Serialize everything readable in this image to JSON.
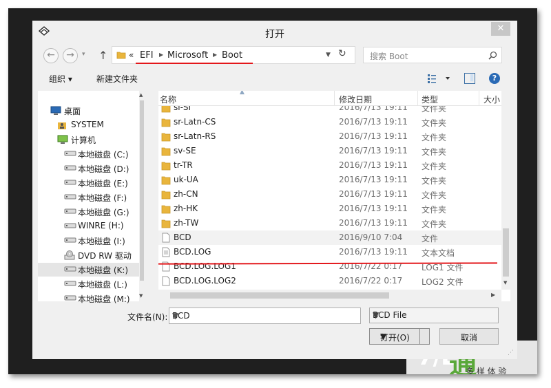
{
  "window": {
    "title": "打开",
    "close_glyph": "✕"
  },
  "address": {
    "chevron": "«",
    "segments": [
      "EFI",
      "Microsoft",
      "Boot"
    ]
  },
  "search": {
    "placeholder": "搜索 Boot"
  },
  "toolbar": {
    "organize": "组织 ▾",
    "new_folder": "新建文件夹"
  },
  "nav_tree": [
    {
      "label": "桌面",
      "icon": "desktop-icon"
    },
    {
      "label": "SYSTEM",
      "icon": "user-folder-icon"
    },
    {
      "label": "计算机",
      "icon": "computer-icon"
    },
    {
      "label": "本地磁盘 (C:)",
      "icon": "drive-icon"
    },
    {
      "label": "本地磁盘 (D:)",
      "icon": "drive-icon"
    },
    {
      "label": "本地磁盘 (E:)",
      "icon": "drive-icon"
    },
    {
      "label": "本地磁盘 (F:)",
      "icon": "drive-icon"
    },
    {
      "label": "本地磁盘 (G:)",
      "icon": "drive-icon"
    },
    {
      "label": "WINRE (H:)",
      "icon": "drive-icon"
    },
    {
      "label": "本地磁盘 (I:)",
      "icon": "drive-icon"
    },
    {
      "label": "DVD RW 驱动",
      "icon": "dvd-drive-icon"
    },
    {
      "label": "本地磁盘 (K:)",
      "icon": "drive-icon",
      "selected": true
    },
    {
      "label": "本地磁盘 (L:)",
      "icon": "drive-icon"
    },
    {
      "label": "本地磁盘 (M:)",
      "icon": "drive-icon"
    }
  ],
  "columns": [
    "名称",
    "修改日期",
    "类型",
    "大小"
  ],
  "files": [
    {
      "name": "sl-SI",
      "date": "2016/7/13 19:11",
      "type": "文件夹",
      "icon": "folder-icon"
    },
    {
      "name": "sr-Latn-CS",
      "date": "2016/7/13 19:11",
      "type": "文件夹",
      "icon": "folder-icon"
    },
    {
      "name": "sr-Latn-RS",
      "date": "2016/7/13 19:11",
      "type": "文件夹",
      "icon": "folder-icon"
    },
    {
      "name": "sv-SE",
      "date": "2016/7/13 19:11",
      "type": "文件夹",
      "icon": "folder-icon"
    },
    {
      "name": "tr-TR",
      "date": "2016/7/13 19:11",
      "type": "文件夹",
      "icon": "folder-icon"
    },
    {
      "name": "uk-UA",
      "date": "2016/7/13 19:11",
      "type": "文件夹",
      "icon": "folder-icon"
    },
    {
      "name": "zh-CN",
      "date": "2016/7/13 19:11",
      "type": "文件夹",
      "icon": "folder-icon"
    },
    {
      "name": "zh-HK",
      "date": "2016/7/13 19:11",
      "type": "文件夹",
      "icon": "folder-icon"
    },
    {
      "name": "zh-TW",
      "date": "2016/7/13 19:11",
      "type": "文件夹",
      "icon": "folder-icon"
    },
    {
      "name": "BCD",
      "date": "2016/9/10 7:04",
      "type": "文件",
      "icon": "file-icon",
      "selected": true
    },
    {
      "name": "BCD.LOG",
      "date": "2016/7/13 19:11",
      "type": "文本文档",
      "icon": "text-file-icon"
    },
    {
      "name": "BCD.LOG.LOG1",
      "date": "2016/7/22 0:17",
      "type": "LOG1 文件",
      "icon": "file-icon"
    },
    {
      "name": "BCD.LOG.LOG2",
      "date": "2016/7/22 0:17",
      "type": "LOG2 文件",
      "icon": "file-icon"
    }
  ],
  "footer": {
    "filename_label": "文件名(N):",
    "filename_value": "BCD",
    "filter_value": "BCD File",
    "open_label": "打开(O)",
    "cancel_label": "取消"
  },
  "colors": {
    "annotation_red": "#e3171b",
    "folder_yellow": "#e9b53c"
  }
}
